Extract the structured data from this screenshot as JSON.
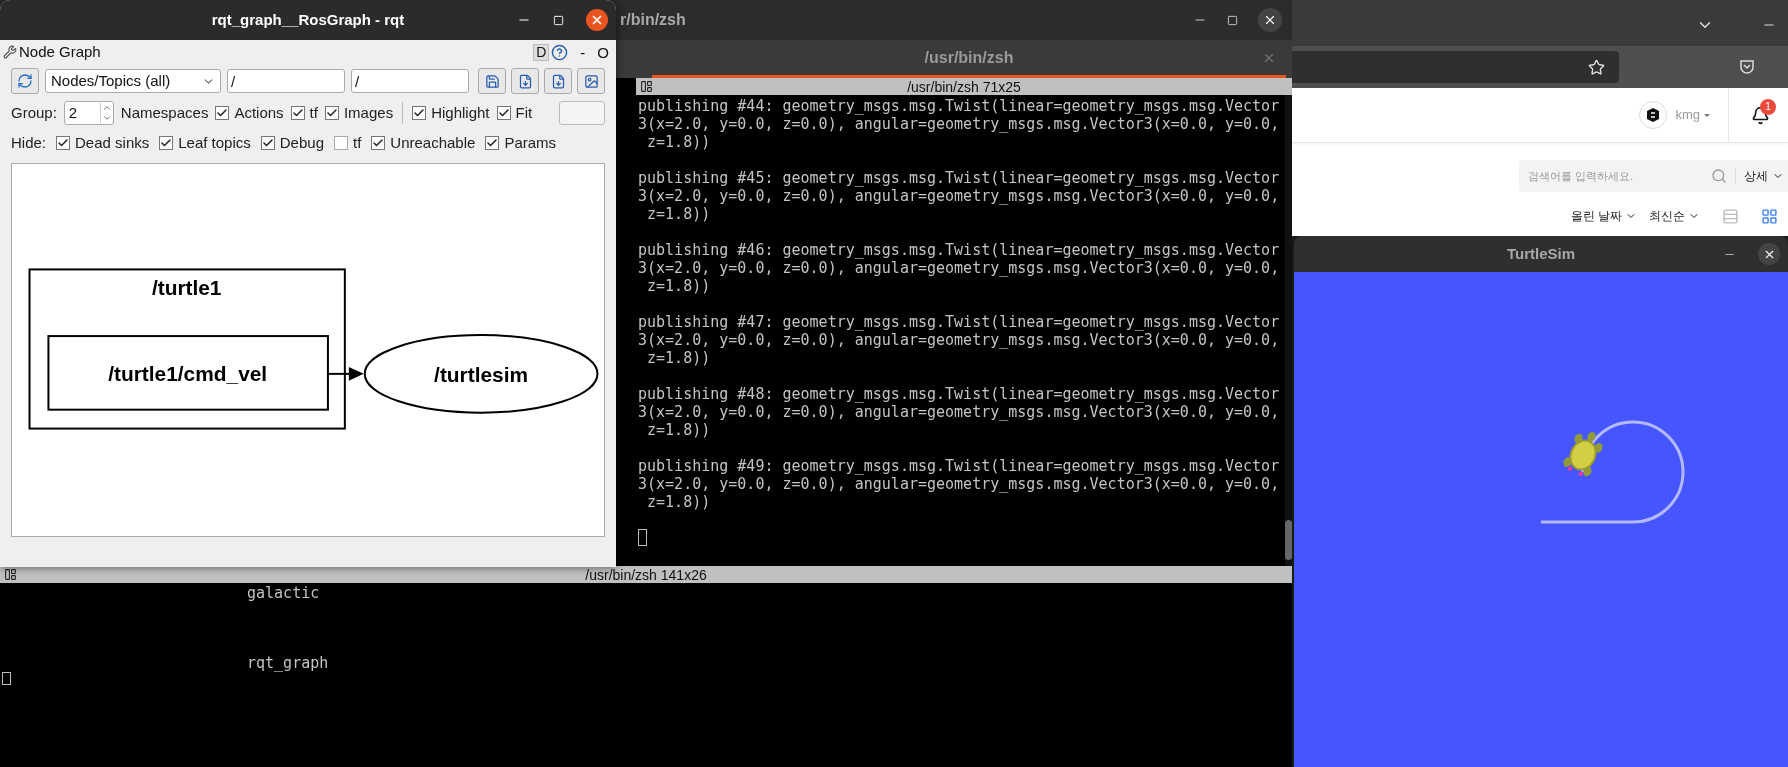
{
  "terminal": {
    "window_title": "r/bin/zsh",
    "tab": "/usr/bin/zsh",
    "top_pane": {
      "header": "/usr/bin/zsh 71x25",
      "messages": [
        {
          "lines": [
            "publishing #44: geometry_msgs.msg.Twist(linear=geometry_msgs.msg.Vector",
            "3(x=2.0, y=0.0, z=0.0), angular=geometry_msgs.msg.Vector3(x=0.0, y=0.0,",
            " z=1.8))"
          ]
        },
        {
          "lines": [
            "publishing #45: geometry_msgs.msg.Twist(linear=geometry_msgs.msg.Vector",
            "3(x=2.0, y=0.0, z=0.0), angular=geometry_msgs.msg.Vector3(x=0.0, y=0.0,",
            " z=1.8))"
          ]
        },
        {
          "lines": [
            "publishing #46: geometry_msgs.msg.Twist(linear=geometry_msgs.msg.Vector",
            "3(x=2.0, y=0.0, z=0.0), angular=geometry_msgs.msg.Vector3(x=0.0, y=0.0,",
            " z=1.8))"
          ]
        },
        {
          "lines": [
            "publishing #47: geometry_msgs.msg.Twist(linear=geometry_msgs.msg.Vector",
            "3(x=2.0, y=0.0, z=0.0), angular=geometry_msgs.msg.Vector3(x=0.0, y=0.0,",
            " z=1.8))"
          ]
        },
        {
          "lines": [
            "publishing #48: geometry_msgs.msg.Twist(linear=geometry_msgs.msg.Vector",
            "3(x=2.0, y=0.0, z=0.0), angular=geometry_msgs.msg.Vector3(x=0.0, y=0.0,",
            " z=1.8))"
          ]
        },
        {
          "lines": [
            "publishing #49: geometry_msgs.msg.Twist(linear=geometry_msgs.msg.Vector",
            "3(x=2.0, y=0.0, z=0.0), angular=geometry_msgs.msg.Vector3(x=0.0, y=0.0,",
            " z=1.8))"
          ]
        }
      ]
    },
    "bottom_pane": {
      "header": "/usr/bin/zsh 141x26",
      "lines": [
        "galactic",
        "rqt_graph"
      ]
    }
  },
  "rqt": {
    "title": "rqt_graph__RosGraph - rqt",
    "plugin_title": "Node Graph",
    "debug_button": "D",
    "minimize_label": "-",
    "close_label": "O",
    "toolbar": {
      "graph_type": "Nodes/Topics (all)",
      "namespace_filter": "/",
      "topic_filter": "/"
    },
    "group": {
      "label": "Group:",
      "value": "2",
      "suffix": "Namespaces"
    },
    "show_options": [
      {
        "label": "Actions",
        "checked": true
      },
      {
        "label": "tf",
        "checked": true
      },
      {
        "label": "Images",
        "checked": true
      }
    ],
    "view_options": [
      {
        "label": "Highlight",
        "checked": true
      },
      {
        "label": "Fit",
        "checked": true
      }
    ],
    "hide": {
      "label": "Hide:",
      "options": [
        {
          "label": "Dead sinks",
          "checked": true
        },
        {
          "label": "Leaf topics",
          "checked": true
        },
        {
          "label": "Debug",
          "checked": true
        },
        {
          "label": "tf",
          "checked": false
        },
        {
          "label": "Unreachable",
          "checked": true
        },
        {
          "label": "Params",
          "checked": true
        }
      ]
    },
    "graph": {
      "namespace": "/turtle1",
      "topic": "/turtle1/cmd_vel",
      "node": "/turtlesim"
    }
  },
  "browser": {
    "user": "kmg",
    "notification_count": "1",
    "search": {
      "placeholder": "검색어를 입력하세요.",
      "detail": "상세"
    },
    "sort": [
      "올린 날짜",
      "최신순"
    ],
    "views": [
      {
        "kind": "list",
        "selected": false
      },
      {
        "kind": "grid",
        "selected": true
      }
    ]
  },
  "turtlesim": {
    "title": "TurtleSim"
  }
}
